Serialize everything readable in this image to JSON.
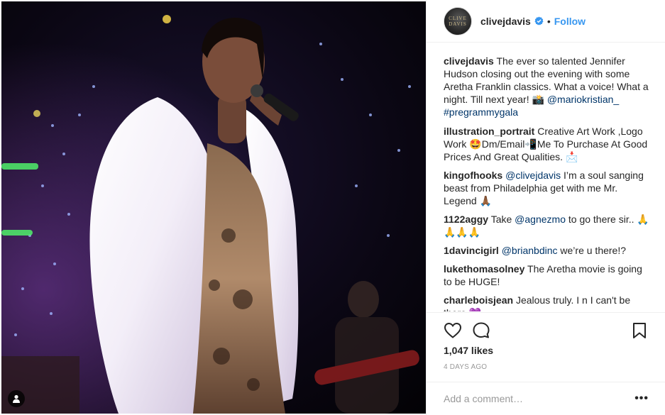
{
  "header": {
    "avatar_text_line1": "CLIVE",
    "avatar_text_line2": "DAVIS",
    "username": "clivejdavis",
    "separator": "•",
    "follow_label": "Follow"
  },
  "caption": {
    "user": "clivejdavis",
    "text": "The ever so talented Jennifer Hudson closing out the evening with some Aretha Franklin classics. What a voice! What a night. Till next year! 📸",
    "mention": "@mariokristian_",
    "hashtag": "#pregrammygala"
  },
  "comments": [
    {
      "user": "illustration_portrait",
      "text": "Creative Art Work ,Logo Work 🤩Dm/Email📲Me To Purchase At Good Prices And Great Qualities. 📩",
      "mention": ""
    },
    {
      "user": "kingofhooks",
      "mention": "@clivejdavis",
      "text": "I’m a soul sanging beast from Philadelphia get with me Mr. Legend 🙏🏾"
    },
    {
      "user": "1122aggy",
      "text_before": "Take",
      "mention": "@agnezmo",
      "text": "to go there sir.. 🙏🙏🙏🙏"
    },
    {
      "user": "1davincigirl",
      "mention": "@brianbdinc",
      "text": "we’re u there!?"
    },
    {
      "user": "lukethomasolney",
      "text": "The Aretha movie is going to be HUGE!",
      "mention": ""
    },
    {
      "user": "charleboisjean",
      "text": "Jealous truly. I n I can't be there 💜",
      "mention": ""
    }
  ],
  "actions": {
    "like_icon": "heart-outline",
    "comment_icon": "speech-bubble",
    "save_icon": "bookmark-outline",
    "likes": "1,047 likes",
    "timestamp": "4 DAYS AGO"
  },
  "add_comment": {
    "placeholder": "Add a comment…",
    "more_label": "•••"
  },
  "colors": {
    "link": "#003569",
    "follow": "#3897f0",
    "verified": "#3897f0",
    "muted": "#999999"
  }
}
